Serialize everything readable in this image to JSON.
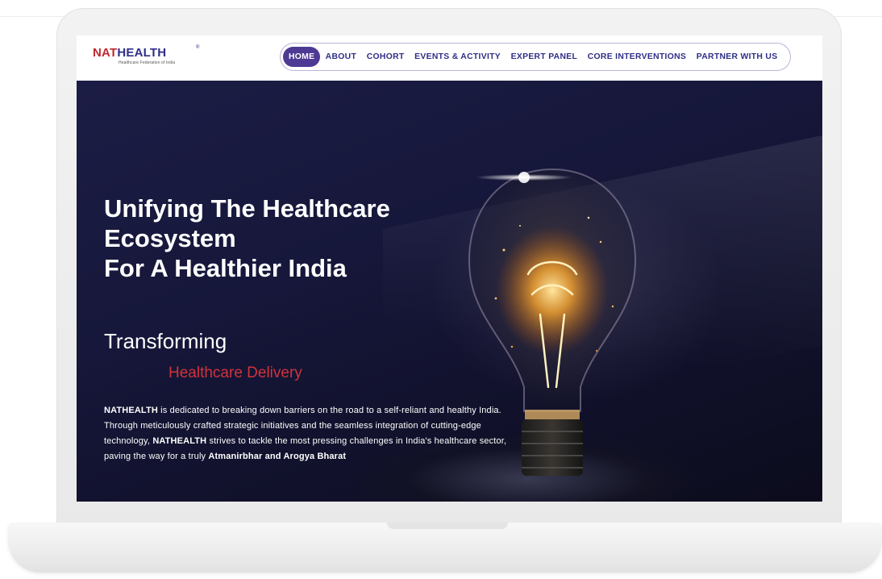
{
  "logo": {
    "nat": "NAT",
    "health": "HEALTH",
    "registered": "®",
    "tagline": "Healthcare Federation of India"
  },
  "nav": {
    "items": [
      {
        "label": "HOME",
        "active": true
      },
      {
        "label": "ABOUT"
      },
      {
        "label": "COHORT"
      },
      {
        "label": "EVENTS & ACTIVITY"
      },
      {
        "label": "EXPERT PANEL"
      },
      {
        "label": "CORE INTERVENTIONS"
      },
      {
        "label": "PARTNER WITH US"
      }
    ]
  },
  "hero": {
    "title_lines": [
      "Unifying The Healthcare",
      "Ecosystem",
      "For A Healthier India"
    ],
    "subtitle_1": "Transforming",
    "subtitle_2": "Healthcare Delivery",
    "paragraph": {
      "brand": "NATHEALTH",
      "p1": " is dedicated to breaking down barriers on the road to a self-reliant and healthy India. Through meticulously crafted strategic initiatives and the seamless integration of cutting-edge technology, ",
      "p2": " strives to tackle the most pressing challenges in India's healthcare sector, paving the way for a truly ",
      "emphasis": "Atmanirbhar and Arogya Bharat"
    }
  },
  "colors": {
    "brand_blue": "#2e2f87",
    "brand_red": "#c0282e",
    "nav_active": "#4e3a94",
    "accent_red": "#d2333a",
    "hero_bg": "#16173a"
  }
}
